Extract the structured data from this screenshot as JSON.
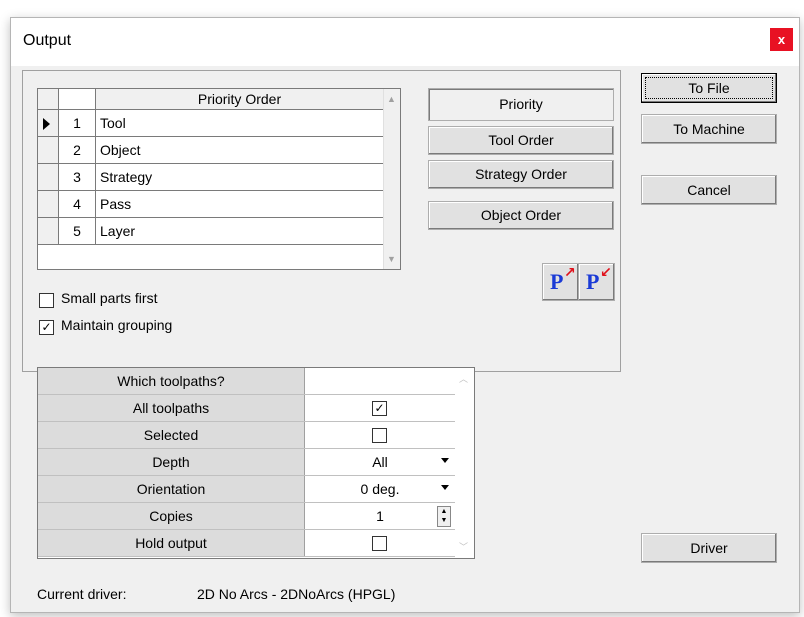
{
  "window": {
    "title": "Output",
    "close_glyph": "x"
  },
  "priority_grid": {
    "header": "Priority Order",
    "current_row_indicator": "triangle-right",
    "rows": [
      {
        "num": "1",
        "label": "Tool"
      },
      {
        "num": "2",
        "label": "Object"
      },
      {
        "num": "3",
        "label": "Strategy"
      },
      {
        "num": "4",
        "label": "Pass"
      },
      {
        "num": "5",
        "label": "Layer"
      }
    ]
  },
  "order_buttons": {
    "priority": "Priority",
    "tool_order": "Tool Order",
    "strategy_order": "Strategy Order",
    "object_order": "Object Order"
  },
  "icon_buttons": {
    "move_up": {
      "letter": "P",
      "icon": "priority-up-icon"
    },
    "move_down": {
      "letter": "P",
      "icon": "priority-down-icon"
    }
  },
  "options": {
    "small_parts_first": {
      "label": "Small parts first",
      "checked": false
    },
    "maintain_grouping": {
      "label": "Maintain grouping",
      "checked": true
    }
  },
  "properties": {
    "rows": [
      {
        "label": "Which toolpaths?",
        "value": "",
        "type": "header"
      },
      {
        "label": "All toolpaths",
        "value": "✓",
        "type": "checkbox",
        "checked": true
      },
      {
        "label": "Selected",
        "value": "",
        "type": "checkbox",
        "checked": false
      },
      {
        "label": "Depth",
        "value": "All",
        "type": "dropdown"
      },
      {
        "label": "Orientation",
        "value": "0 deg.",
        "type": "dropdown"
      },
      {
        "label": "Copies",
        "value": "1",
        "type": "spinner"
      },
      {
        "label": "Hold output",
        "value": "",
        "type": "checkbox",
        "checked": false
      }
    ]
  },
  "side_buttons": {
    "to_file": "To File",
    "to_machine": "To Machine",
    "cancel": "Cancel",
    "driver": "Driver"
  },
  "footer": {
    "current_driver_label": "Current driver:",
    "current_driver_value": "2D No Arcs - 2DNoArcs (HPGL)"
  },
  "colors": {
    "close_button": "#e81123",
    "p_icon": "#1a3ad6",
    "p_arrow": "#e0101a"
  }
}
